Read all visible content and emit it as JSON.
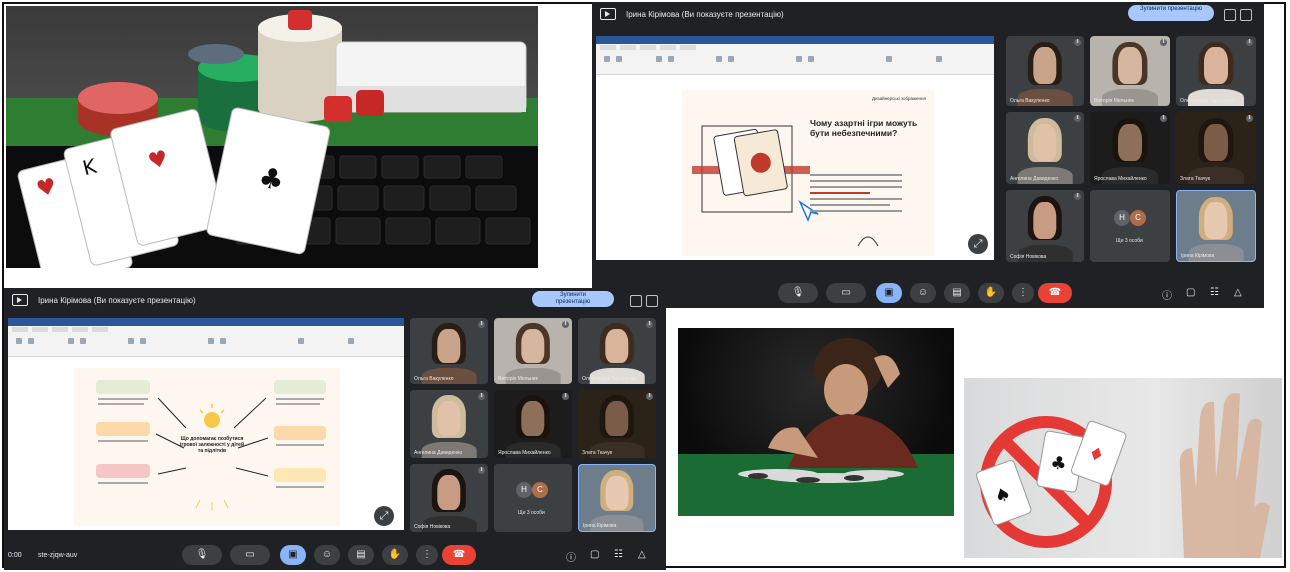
{
  "meet_top": {
    "title": "Ірина Кірімова (Ви показуєте презентацію)",
    "stop_label": "Зупинити презентацію",
    "more_label": "Ще 3 особи",
    "time": "",
    "call_code": "",
    "slide": {
      "heading": "Чому азартні ігри можуть бути небезпечними?",
      "author": "Дизайнерські зображення"
    },
    "participants": [
      {
        "name": "Ольга Вакуленко"
      },
      {
        "name": "Вікторія Мельник"
      },
      {
        "name": "Олександра Тарасенко"
      },
      {
        "name": "Ангелина Давиденко"
      },
      {
        "name": "Ярослава Михайленко"
      },
      {
        "name": "Злата Ткачук"
      },
      {
        "name": "Софія Новікова"
      },
      {
        "name": ""
      },
      {
        "name": "Ірина Кірімова"
      }
    ]
  },
  "meet_bottom": {
    "title": "Ірина Кірімова (Ви показуєте презентацію)",
    "stop_label": "Зупинити презентацію",
    "more_label": "Ще 3 особи",
    "time": "0:00",
    "call_code": "ste-zjqw-auv",
    "slide": {
      "center_text": "Що допомагає позбутися ігрової залежності у дітей та підлітків"
    },
    "participants": [
      {
        "name": "Ольга Вакуленко"
      },
      {
        "name": "Вікторія Мельник"
      },
      {
        "name": "Олександра Тарасенко"
      },
      {
        "name": "Ангелина Давиденко"
      },
      {
        "name": "Ярослава Михайленко"
      },
      {
        "name": "Злата Ткачук"
      },
      {
        "name": "Софія Новікова"
      },
      {
        "name": ""
      },
      {
        "name": "Ірина Кірімова"
      }
    ]
  },
  "avatars": [
    "Н",
    "С"
  ],
  "icons": {
    "present": "present-to-all-icon",
    "mic": "microphone-icon",
    "camera": "camera-icon",
    "captions": "captions-icon",
    "emoji": "emoji-icon",
    "share": "present-icon",
    "hand": "raise-hand-icon",
    "more": "more-vert-icon",
    "end": "call-end-icon",
    "info": "info-icon",
    "chat": "chat-icon",
    "people": "people-icon",
    "activities": "activities-icon",
    "fullscreen": "fullscreen-icon"
  },
  "colors": {
    "meet_bg": "#202124",
    "accent": "#8ab4f8",
    "end_call": "#ea4335",
    "stop_button": "#a8c7fa"
  }
}
